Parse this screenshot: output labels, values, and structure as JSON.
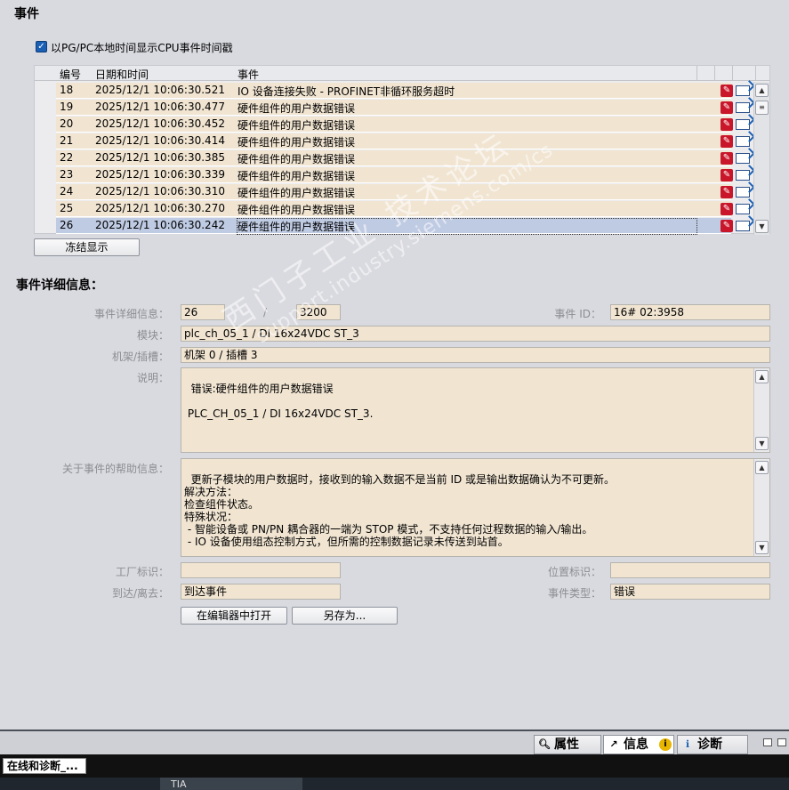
{
  "section": {
    "title": "事件",
    "details_title": "事件详细信息："
  },
  "checkbox": {
    "checked": true,
    "label": "以PG/PC本地时间显示CPU事件时间戳"
  },
  "table": {
    "headers": {
      "id": "编号",
      "datetime": "日期和时间",
      "event": "事件"
    },
    "rows": [
      {
        "id": "18",
        "datetime": "2025/12/1 10:06:30.521",
        "event": "IO 设备连接失败 - PROFINET非循环服务超时"
      },
      {
        "id": "19",
        "datetime": "2025/12/1 10:06:30.477",
        "event": "硬件组件的用户数据错误"
      },
      {
        "id": "20",
        "datetime": "2025/12/1 10:06:30.452",
        "event": "硬件组件的用户数据错误"
      },
      {
        "id": "21",
        "datetime": "2025/12/1 10:06:30.414",
        "event": "硬件组件的用户数据错误"
      },
      {
        "id": "22",
        "datetime": "2025/12/1 10:06:30.385",
        "event": "硬件组件的用户数据错误"
      },
      {
        "id": "23",
        "datetime": "2025/12/1 10:06:30.339",
        "event": "硬件组件的用户数据错误"
      },
      {
        "id": "24",
        "datetime": "2025/12/1 10:06:30.310",
        "event": "硬件组件的用户数据错误"
      },
      {
        "id": "25",
        "datetime": "2025/12/1 10:06:30.270",
        "event": "硬件组件的用户数据错误"
      },
      {
        "id": "26",
        "datetime": "2025/12/1 10:06:30.242",
        "event": "硬件组件的用户数据错误",
        "selected": true
      }
    ]
  },
  "buttons": {
    "freeze": "冻结显示",
    "open_editor": "在编辑器中打开",
    "save_as": "另存为..."
  },
  "details": {
    "detail_label": "事件详细信息：",
    "detail_value": "26",
    "separator": "/",
    "detail_total": "3200",
    "event_id_label": "事件 ID：",
    "event_id_value": "16# 02:3958",
    "module_label": "模块：",
    "module_value": "plc_ch_05_1 / DI 16x24VDC ST_3",
    "rack_label": "机架/插槽：",
    "rack_value": "机架 0 / 插槽 3",
    "desc_label": "说明：",
    "desc_value": "错误:硬件组件的用户数据错误\n\n PLC_CH_05_1 / DI 16x24VDC ST_3.",
    "help_label": "关于事件的帮助信息：",
    "help_value": "更新子模块的用户数据时，接收到的输入数据不是当前 ID 或是输出数据确认为不可更新。\n解决方法：\n检查组件状态。\n特殊状况：\n - 智能设备或 PN/PN 耦合器的一端为 STOP 模式，不支持任何过程数据的输入/输出。\n - IO 设备使用组态控制方式，但所需的控制数据记录未传送到站首。",
    "plant_label": "工厂标识：",
    "plant_value": "",
    "location_label": "位置标识：",
    "location_value": "",
    "arrive_label": "到达/离去：",
    "arrive_value": "到达事件",
    "type_label": "事件类型：",
    "type_value": "错误"
  },
  "watermark": {
    "line1": "西门子工业 技术论坛",
    "line2": "support.industry.siemens.com/cs"
  },
  "tabs": [
    {
      "label": "属性",
      "icon": "magnifier-icon"
    },
    {
      "label": "信息",
      "icon": "info-icon",
      "active": true
    },
    {
      "label": "诊断",
      "icon": "diagnostics-icon"
    }
  ],
  "taskbar": {
    "item": "在线和诊断_...",
    "app": "TIA"
  },
  "colors": {
    "row_bg": "#f1e5d2",
    "row_selected": "#bfcbe3",
    "error_red": "#c9162a",
    "bg": "#d9dae0"
  }
}
